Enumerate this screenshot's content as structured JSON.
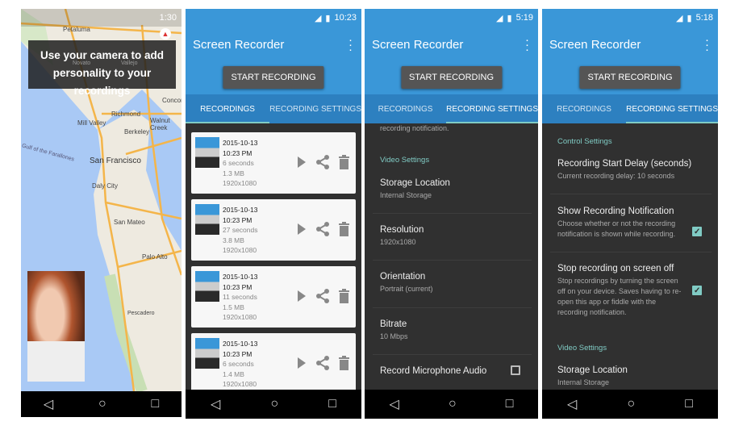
{
  "screen1": {
    "status_time": "1:30",
    "overlay_text_line1": "Use your camera to add",
    "overlay_text_line2": "personality to your recordings",
    "map_labels": [
      "Petaluma",
      "Novato",
      "Vallejo",
      "Concord",
      "Richmond",
      "Mill Valley",
      "Walnut Creek",
      "Berkeley",
      "San Francisco",
      "Daly City",
      "San Mateo",
      "Palo Alto",
      "Pescadero",
      "Gulf of the Farallones"
    ],
    "colors": {
      "water": "#a9c9f5",
      "land": "#eeeae0",
      "road": "#f4b54a"
    }
  },
  "screen2": {
    "status_time": "10:23",
    "app_title": "Screen Recorder",
    "start_button": "START RECORDING",
    "tabs": [
      {
        "label": "RECORDINGS",
        "active": true
      },
      {
        "label": "RECORDING SETTINGS",
        "active": false
      }
    ],
    "recordings": [
      {
        "date": "2015-10-13",
        "time": "10:23 PM",
        "duration": "6 seconds",
        "size": "1.3 MB",
        "resolution": "1920x1080"
      },
      {
        "date": "2015-10-13",
        "time": "10:23 PM",
        "duration": "27 seconds",
        "size": "3.8 MB",
        "resolution": "1920x1080"
      },
      {
        "date": "2015-10-13",
        "time": "10:23 PM",
        "duration": "11 seconds",
        "size": "1.5 MB",
        "resolution": "1920x1080"
      },
      {
        "date": "2015-10-13",
        "time": "10:23 PM",
        "duration": "6 seconds",
        "size": "1.4 MB",
        "resolution": "1920x1080"
      }
    ]
  },
  "screen3": {
    "status_time": "5:19",
    "app_title": "Screen Recorder",
    "start_button": "START RECORDING",
    "tabs": [
      {
        "label": "RECORDINGS",
        "active": false
      },
      {
        "label": "RECORDING SETTINGS",
        "active": true
      }
    ],
    "partial_text": "recording notification.",
    "section": "Video Settings",
    "settings": [
      {
        "title": "Storage Location",
        "summary": "Internal Storage"
      },
      {
        "title": "Resolution",
        "summary": "1920x1080"
      },
      {
        "title": "Orientation",
        "summary": "Portrait (current)"
      },
      {
        "title": "Bitrate",
        "summary": "10 Mbps"
      },
      {
        "title": "Record Microphone Audio",
        "checked": false
      }
    ]
  },
  "screen4": {
    "status_time": "5:18",
    "app_title": "Screen Recorder",
    "start_button": "START RECORDING",
    "tabs": [
      {
        "label": "RECORDINGS",
        "active": false
      },
      {
        "label": "RECORDING SETTINGS",
        "active": true
      }
    ],
    "section1": "Control Settings",
    "settings": [
      {
        "title": "Recording Start Delay (seconds)",
        "summary": "Current recording delay: 10 seconds"
      },
      {
        "title": "Show Recording Notification",
        "summary": "Choose whether or not the recording notification is shown while recording.",
        "checked": true
      },
      {
        "title": "Stop recording on screen off",
        "summary": "Stop recordings by turning the screen off on your device. Saves having to re-open this app or fiddle with the recording notification.",
        "checked": true
      }
    ],
    "section2": "Video Settings",
    "storage": {
      "title": "Storage Location",
      "summary": "Internal Storage"
    }
  },
  "colors": {
    "primary": "#3a97d8",
    "tabbar": "#2d80c0",
    "accent": "#80cbc4",
    "background": "#303030"
  }
}
